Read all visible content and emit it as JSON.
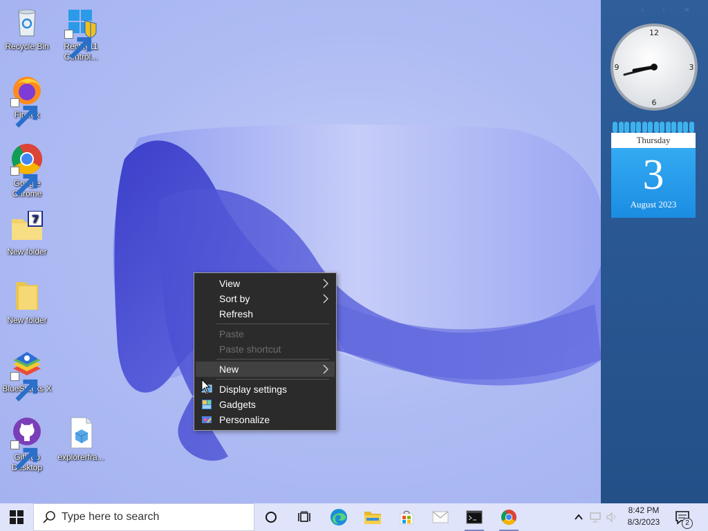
{
  "desktop": {
    "icons": [
      {
        "name": "recycle-bin",
        "label": "Recycle Bin"
      },
      {
        "name": "rectify11",
        "label": "Rectify11 Control..."
      },
      {
        "name": "firefox",
        "label": "Firefox"
      },
      {
        "name": "chrome",
        "label": "Google Chrome"
      },
      {
        "name": "new-folder-7z",
        "label": "New folder"
      },
      {
        "name": "new-folder",
        "label": "New folder"
      },
      {
        "name": "bluestacks",
        "label": "BlueStacks X"
      },
      {
        "name": "github-desktop",
        "label": "GitHub Desktop"
      },
      {
        "name": "explorerframe",
        "label": "explorerfra..."
      }
    ]
  },
  "context_menu": {
    "items": [
      {
        "label": "View",
        "submenu": true,
        "disabled": false
      },
      {
        "label": "Sort by",
        "submenu": true,
        "disabled": false
      },
      {
        "label": "Refresh",
        "submenu": false,
        "disabled": false
      },
      {
        "label": "Paste",
        "submenu": false,
        "disabled": true
      },
      {
        "label": "Paste shortcut",
        "submenu": false,
        "disabled": true
      },
      {
        "label": "New",
        "submenu": true,
        "disabled": false,
        "highlighted": true
      },
      {
        "label": "Display settings",
        "icon": "display-icon"
      },
      {
        "label": "Gadgets",
        "icon": "gadgets-icon"
      },
      {
        "label": "Personalize",
        "icon": "personalize-icon"
      }
    ]
  },
  "sidebar": {
    "clock": {
      "numerals": [
        "12",
        "3",
        "6",
        "9"
      ],
      "time": "8:42"
    },
    "calendar": {
      "weekday": "Thursday",
      "day": "3",
      "month_year": "August 2023"
    }
  },
  "taskbar": {
    "search_placeholder": "Type here to search",
    "pinned": [
      "cortana-icon",
      "task-view-icon",
      "edge-icon",
      "file-explorer-icon",
      "store-icon",
      "mail-icon",
      "terminal-icon",
      "chrome-icon"
    ],
    "time": "8:42 PM",
    "date": "8/3/2023",
    "notification_count": "2"
  },
  "colors": {
    "taskbar_bg": "#dfe4fa",
    "sidebar_bg": "#2a5893",
    "menu_bg": "#2b2b2b",
    "calendar_blue": "#1b8de2"
  }
}
